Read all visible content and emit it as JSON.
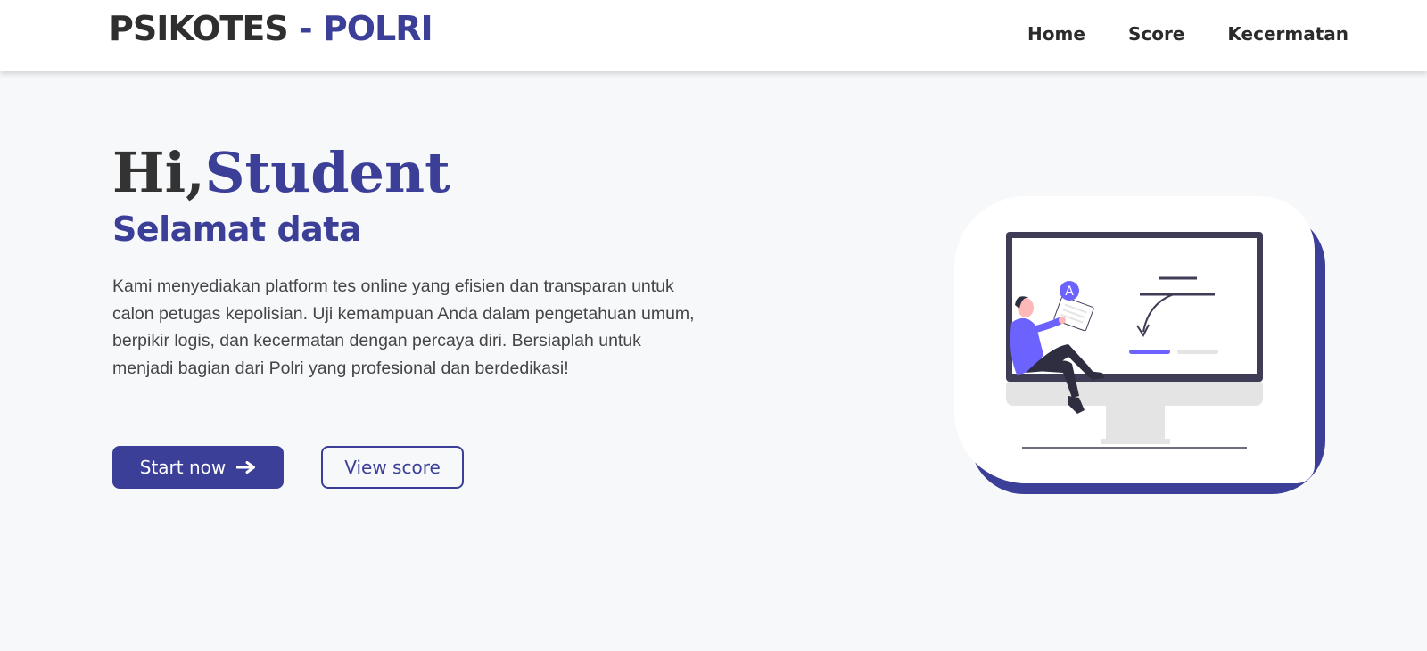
{
  "navbar": {
    "brand_main": "PSIKOTES",
    "brand_separator": " - ",
    "brand_accent": "POLRI",
    "links": [
      {
        "label": "Home"
      },
      {
        "label": "Score"
      },
      {
        "label": "Kecermatan"
      }
    ]
  },
  "hero": {
    "greeting_prefix": "Hi,",
    "greeting_name": "Student",
    "subtitle": "Selamat data",
    "description": "Kami menyediakan platform tes online yang efisien dan transparan untuk calon petugas kepolisian. Uji kemampuan Anda dalam pengetahuan umum, berpikir logis, dan kecermatan dengan percaya diri. Bersiaplah untuk menjadi bagian dari Polri yang profesional dan berdedikasi!",
    "primary_button": {
      "label": "Start now",
      "icon": "arrow-right-icon"
    },
    "secondary_button": {
      "label": "View score"
    }
  },
  "illustration": {
    "badge_letter": "A",
    "icon": "person-at-monitor-illustration"
  },
  "colors": {
    "accent": "#3b3f98",
    "background": "#f7f8fa",
    "text_dark": "#2f2f2f",
    "illustration_purple": "#6c63ff"
  }
}
